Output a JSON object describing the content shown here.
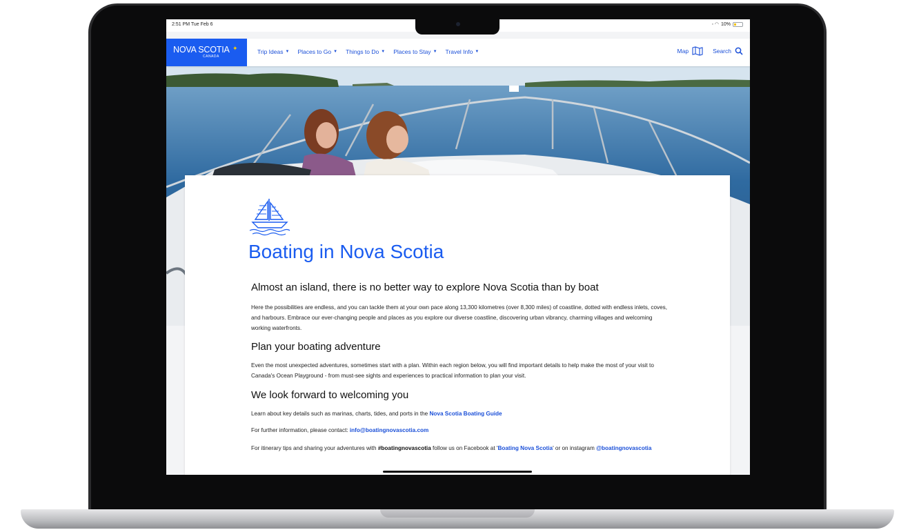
{
  "status_bar": {
    "time": "2:51 PM  Tue Feb 6",
    "battery": "10%"
  },
  "nav": {
    "logo_title": "NOVA SCOTIA",
    "logo_sub": "CANADA",
    "items": [
      {
        "label": "Trip Ideas"
      },
      {
        "label": "Places to Go"
      },
      {
        "label": "Things to Do"
      },
      {
        "label": "Places to Stay"
      },
      {
        "label": "Travel Info"
      }
    ],
    "map_label": "Map",
    "search_label": "Search"
  },
  "content": {
    "title": "Boating in Nova Scotia",
    "section1": {
      "heading": "Almost an island, there is no better way to explore Nova Scotia than by boat",
      "body": "Here the possibilities are endless, and you can tackle them at your own pace along 13,300 kilometres (over 8,300 miles) of coastline, dotted with endless inlets, coves, and harbours. Embrace our ever-changing people and places as you explore our diverse coastline, discovering urban vibrancy, charming villages and welcoming working waterfronts."
    },
    "section2": {
      "heading": "Plan your boating adventure",
      "body": "Even the most unexpected adventures, sometimes start with a plan. Within each region below, you will find important details to help make the most of your visit to Canada's Ocean Playground - from must-see sights and experiences to practical information to plan your visit."
    },
    "section3": {
      "heading": "We look forward to welcoming you",
      "guide_text": "Learn about key details such as marinas, charts, tides, and ports in the ",
      "guide_link": "Nova Scotia Boating Guide",
      "contact_text": "For further information, please contact: ",
      "contact_link": "info@boatingnovascotia.com",
      "social_text_1": "For itinerary tips and sharing your adventures with ",
      "hashtag": "#boatingnovascotia",
      "social_text_2": " follow us on Facebook at '",
      "facebook_link": "Boating Nova Scotia",
      "social_text_3": "' or on instagram ",
      "instagram_link": "@boatingnovascotia"
    }
  },
  "colors": {
    "brand_blue": "#1a5cf0",
    "link_blue": "#1a4fd8"
  }
}
